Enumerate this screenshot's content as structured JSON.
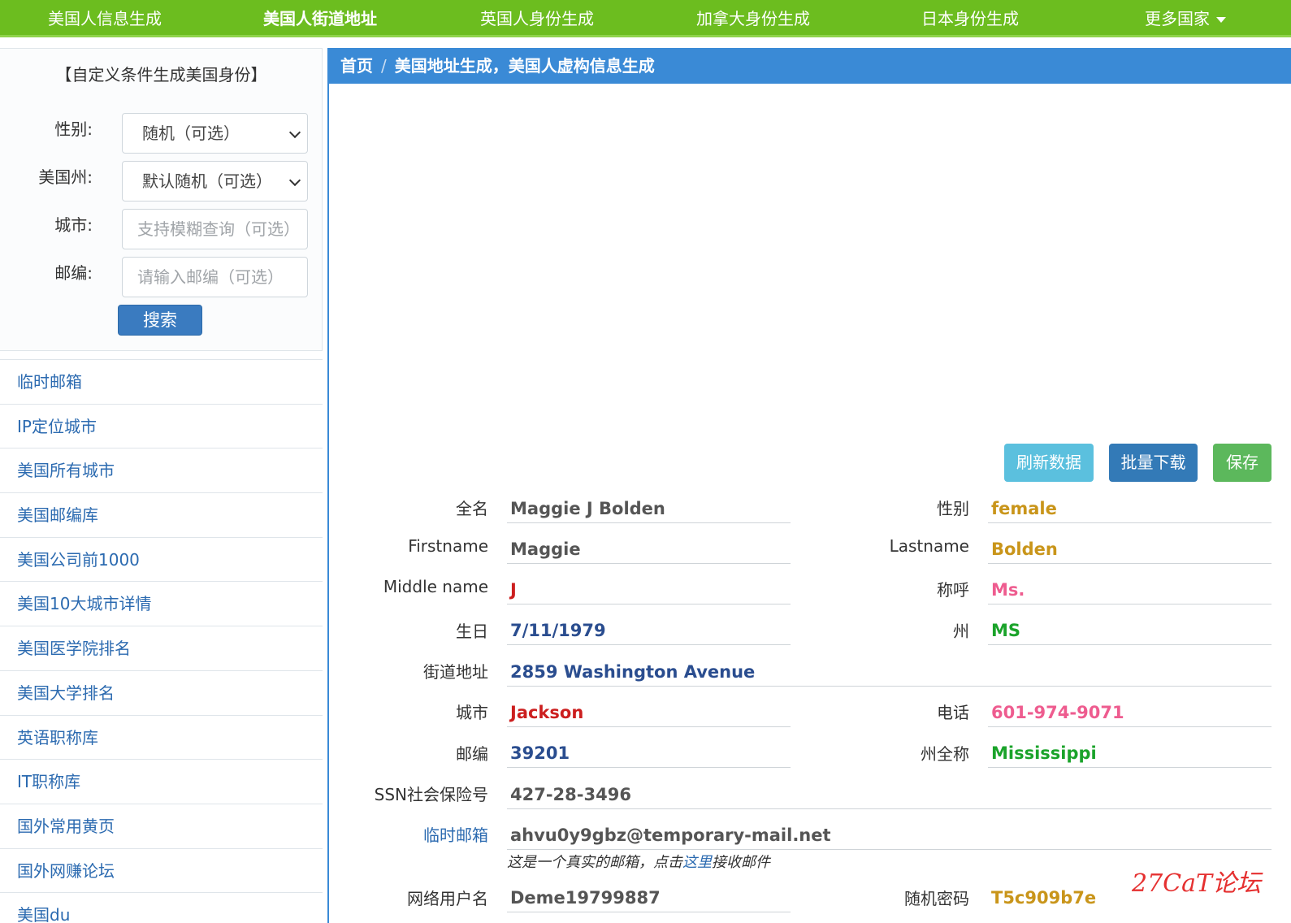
{
  "nav": {
    "items": [
      "美国人信息生成",
      "美国人街道地址",
      "英国人身份生成",
      "加拿大身份生成",
      "日本身份生成"
    ],
    "more": "更多国家"
  },
  "form": {
    "title": "【自定义条件生成美国身份】",
    "gender_label": "性别:",
    "gender_value": "随机（可选）",
    "state_label": "美国州:",
    "state_value": "默认随机（可选）",
    "city_label": "城市:",
    "city_placeholder": "支持模糊查询（可选）",
    "zip_label": "邮编:",
    "zip_placeholder": "请输入邮编（可选）",
    "search": "搜索"
  },
  "links": [
    "临时邮箱",
    "IP定位城市",
    "美国所有城市",
    "美国邮编库",
    "美国公司前1000",
    "美国10大城市详情",
    "美国医学院排名",
    "美国大学排名",
    "英语职称库",
    "IT职称库",
    "国外常用黄页",
    "国外网赚论坛",
    "美国du"
  ],
  "breadcrumb": {
    "home": "首页",
    "sep": "/",
    "current": "美国地址生成，美国人虚构信息生成"
  },
  "buttons": {
    "refresh": "刷新数据",
    "batch": "批量下载",
    "save": "保存"
  },
  "fields": {
    "fullname": {
      "label": "全名",
      "value": "Maggie J Bolden"
    },
    "gender": {
      "label": "性别",
      "value": "female"
    },
    "firstname": {
      "label": "Firstname",
      "value": "Maggie"
    },
    "lastname": {
      "label": "Lastname",
      "value": "Bolden"
    },
    "middlename": {
      "label": "Middle name",
      "value": "J"
    },
    "title": {
      "label": "称呼",
      "value": "Ms."
    },
    "birthday": {
      "label": "生日",
      "value": "7/11/1979"
    },
    "state": {
      "label": "州",
      "value": "MS"
    },
    "street": {
      "label": "街道地址",
      "value": "2859 Washington Avenue"
    },
    "city": {
      "label": "城市",
      "value": "Jackson"
    },
    "phone": {
      "label": "电话",
      "value": "601-974-9071"
    },
    "zip": {
      "label": "邮编",
      "value": "39201"
    },
    "statefull": {
      "label": "州全称",
      "value": "Mississippi"
    },
    "ssn": {
      "label": "SSN社会保险号",
      "value": "427-28-3496"
    },
    "email": {
      "label": "临时邮箱",
      "value": "ahvu0y9gbz@temporary-mail.net"
    },
    "username": {
      "label": "网络用户名",
      "value": "Deme19799887"
    },
    "password": {
      "label": "随机密码",
      "value": "T5c909b7e"
    }
  },
  "email_note": {
    "before": "这是一个真实的邮箱，点击",
    "link": "这里",
    "after": "接收邮件"
  },
  "watermark": "27CaT论坛",
  "colors": {
    "nav_green": "#6cbd1f",
    "header_blue": "#3a8ad6",
    "dark": "#555555",
    "gold": "#c9951a",
    "red": "#cc1f1f",
    "pink": "#ee5c8f",
    "green": "#1aa32a",
    "navy": "#2a4d8f"
  }
}
